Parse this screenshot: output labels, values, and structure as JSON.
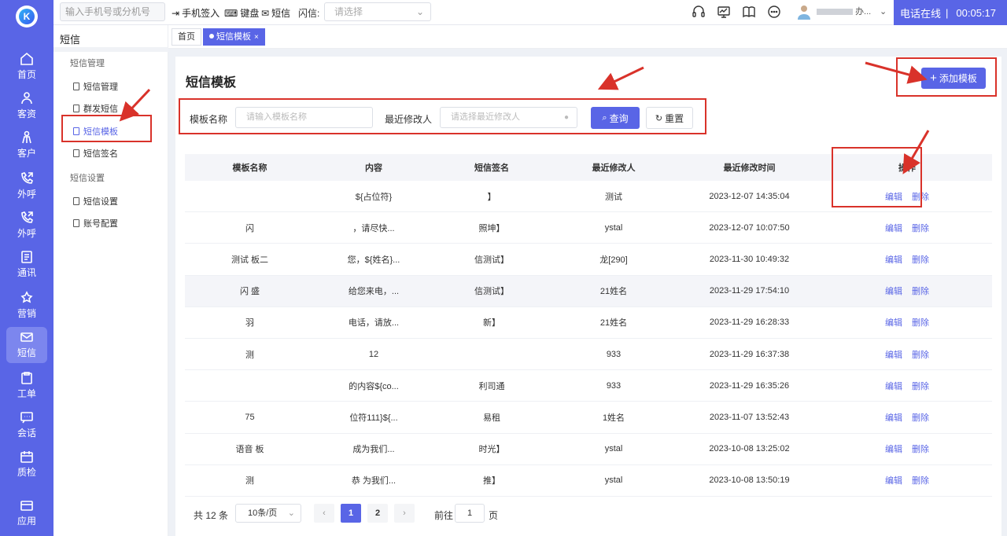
{
  "rail": {
    "items": [
      {
        "label": "首页",
        "icon": "home-icon"
      },
      {
        "label": "客资",
        "icon": "users-icon"
      },
      {
        "label": "客户",
        "icon": "customer-icon"
      },
      {
        "label": "外呼",
        "icon": "phone-out-icon"
      },
      {
        "label": "外呼",
        "icon": "phone-out-icon"
      },
      {
        "label": "通讯",
        "icon": "contacts-icon"
      },
      {
        "label": "营销",
        "icon": "marketing-icon"
      },
      {
        "label": "短信",
        "icon": "message-icon",
        "active": true
      },
      {
        "label": "工单",
        "icon": "clipboard-icon"
      },
      {
        "label": "会话",
        "icon": "chat-icon"
      },
      {
        "label": "质检",
        "icon": "calendar-icon"
      },
      {
        "label": "应用",
        "icon": "app-icon"
      }
    ]
  },
  "topbar": {
    "phone_placeholder": "输入手机号或分机号",
    "sign_in": "手机签入",
    "keypad": "键盘",
    "sms": "短信",
    "flash_label": "闪信:",
    "flash_placeholder": "请选择",
    "user_suffix": "办...",
    "status": "电话在线",
    "separator": "|",
    "timer": "00:05:17"
  },
  "subnav": {
    "title": "短信",
    "group1": "短信管理",
    "items1": [
      "短信管理",
      "群发短信",
      "短信模板",
      "短信签名"
    ],
    "group2": "短信设置",
    "items2": [
      "短信设置",
      "账号配置"
    ]
  },
  "tabs": {
    "home": "首页",
    "current": "短信模板",
    "close": "×"
  },
  "page": {
    "title": "短信模板",
    "add_button": "添加模板",
    "filter_name_label": "模板名称",
    "filter_name_placeholder": "请输入模板名称",
    "filter_modifier_label": "最近修改人",
    "filter_modifier_placeholder": "请选择最近修改人",
    "query_button": "查询",
    "reset_button": "重置"
  },
  "table": {
    "headers": [
      "模板名称",
      "内容",
      "短信签名",
      "最近修改人",
      "最近修改时间",
      "操作"
    ],
    "rows": [
      [
        "",
        "${占位符}",
        "】",
        "测试",
        "2023-12-07 14:35:04"
      ],
      [
        "闪",
        "，请尽快...",
        "照坤】",
        "ystal",
        "2023-12-07 10:07:50"
      ],
      [
        "测试 板二",
        "您，${姓名}...",
        "信测试】",
        "龙[290]",
        "2023-11-30 10:49:32"
      ],
      [
        "闪 盛",
        "给您来电，...",
        "信测试】",
        "21姓名",
        "2023-11-29 17:54:10"
      ],
      [
        "羽",
        "电话，请放...",
        "新】",
        "21姓名",
        "2023-11-29 16:28:33"
      ],
      [
        "测",
        "12",
        "",
        "933",
        "2023-11-29 16:37:38"
      ],
      [
        "",
        "的内容${co...",
        "利司通",
        "933",
        "2023-11-29 16:35:26"
      ],
      [
        "75",
        "位符111}${...",
        "易租",
        "1姓名",
        "2023-11-07 13:52:43"
      ],
      [
        "语音 板",
        "成为我们...",
        "时光】",
        "ystal",
        "2023-10-08 13:25:02"
      ],
      [
        "测",
        "恭 为我们...",
        "推】",
        "ystal",
        "2023-10-08 13:50:19"
      ]
    ],
    "edit": "编辑",
    "delete": "删除"
  },
  "pager": {
    "total": "共 12 条",
    "page_size": "10条/页",
    "prev": "‹",
    "next": "›",
    "pages": [
      "1",
      "2"
    ],
    "goto": "前往",
    "goto_value": "1",
    "unit": "页"
  },
  "colors": {
    "accent": "#5965e6",
    "annotation": "#d9322a"
  }
}
